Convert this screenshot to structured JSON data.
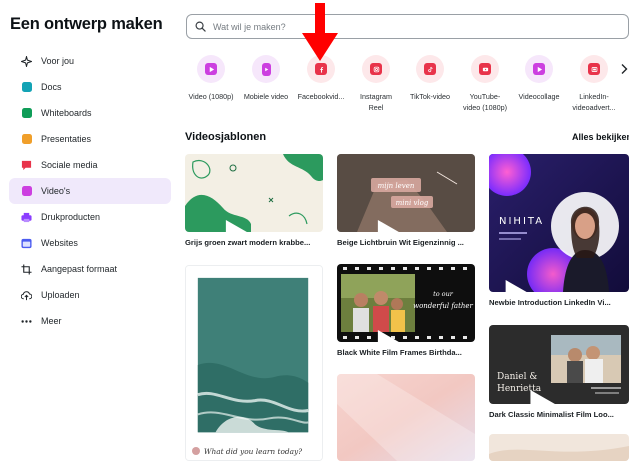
{
  "app": {
    "title": "Een ontwerp maken"
  },
  "sidebar": {
    "items": [
      {
        "label": "Voor jou",
        "icon": "sparkle-icon"
      },
      {
        "label": "Docs",
        "icon": "docs-icon",
        "color": "#13a3b5"
      },
      {
        "label": "Whiteboards",
        "icon": "whiteboard-icon",
        "color": "#0f9d58"
      },
      {
        "label": "Presentaties",
        "icon": "presentation-icon",
        "color": "#f09f2a"
      },
      {
        "label": "Sociale media",
        "icon": "social-media-icon",
        "color": "#e8334a"
      },
      {
        "label": "Video's",
        "icon": "video-icon",
        "color": "#cc3fe0"
      },
      {
        "label": "Drukproducten",
        "icon": "print-icon",
        "color": "#8b3dff"
      },
      {
        "label": "Websites",
        "icon": "website-icon",
        "color": "#4b5cf0"
      },
      {
        "label": "Aangepast formaat",
        "icon": "custom-size-icon"
      },
      {
        "label": "Uploaden",
        "icon": "upload-icon"
      },
      {
        "label": "Meer",
        "icon": "more-icon"
      }
    ],
    "active_index": 5
  },
  "search": {
    "placeholder": "Wat wil je maken?"
  },
  "categories": [
    {
      "label": "Video (1080p)",
      "color": "#cc3fe0"
    },
    {
      "label": "Mobiele video",
      "color": "#cc3fe0"
    },
    {
      "label": "Facebookvid...",
      "color": "#e8334a"
    },
    {
      "label": "Instagram",
      "label2": "Reel",
      "color": "#e8334a"
    },
    {
      "label": "TikTok-video",
      "color": "#e8334a"
    },
    {
      "label": "YouTube-",
      "label2": "video (1080p)",
      "color": "#e8334a"
    },
    {
      "label": "Videocollage",
      "color": "#cc3fe0"
    },
    {
      "label": "LinkedIn-",
      "label2": "videoadvert...",
      "color": "#e8334a"
    }
  ],
  "section": {
    "title": "Videosjablonen",
    "see_all": "Alles bekijken"
  },
  "templates": [
    {
      "caption": "Grijs groen zwart modern krabbe..."
    },
    {
      "caption": "Beige Lichtbruin Wit Eigenzinnig ...",
      "text1": "mijn leven",
      "text2": "mini vlog"
    },
    {
      "caption": "Newbie Introduction LinkedIn Vi...",
      "text1": "NIHITA"
    },
    {
      "caption": "",
      "text1": "What did you learn today?"
    },
    {
      "caption": "Black White Film Frames Birthda...",
      "text1": "to our",
      "text2": "wonderful father"
    },
    {
      "caption": "Dark Classic Minimalist Film Loo...",
      "text1": "Daniel &",
      "text2": "Henrietta"
    }
  ],
  "colors": {
    "accent": "#8b3dff",
    "active_bg": "#f0e9fb",
    "annotation": "#ff0000"
  }
}
